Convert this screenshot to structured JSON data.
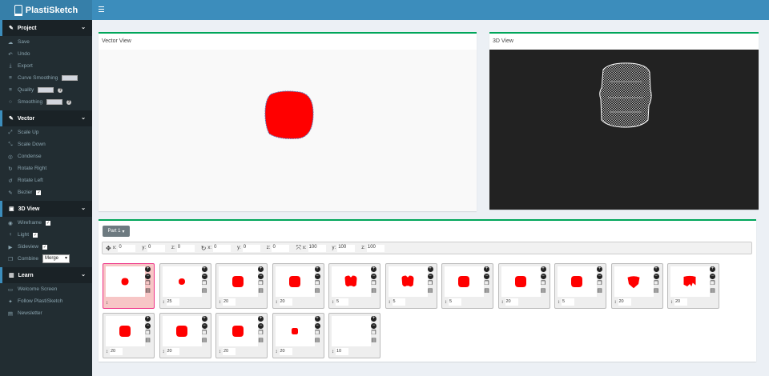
{
  "app": {
    "title": "PlastiSketch"
  },
  "sidebar": {
    "project": {
      "title": "Project",
      "items": [
        {
          "icon": "cloud-save-icon",
          "glyph": "☁",
          "label": "Save"
        },
        {
          "icon": "undo-icon",
          "glyph": "↶",
          "label": "Undo"
        },
        {
          "icon": "download-icon",
          "glyph": "⤓",
          "label": "Export"
        },
        {
          "icon": "sliders-icon",
          "glyph": "≡",
          "label": "Curve Smoothing"
        },
        {
          "icon": "sliders-icon",
          "glyph": "≡",
          "label": "Quality"
        },
        {
          "icon": "circle-icon",
          "glyph": "○",
          "label": "Smoothing"
        }
      ]
    },
    "vector": {
      "title": "Vector",
      "items": [
        {
          "icon": "expand-icon",
          "glyph": "⤢",
          "label": "Scale Up"
        },
        {
          "icon": "compress-icon",
          "glyph": "⤡",
          "label": "Scale Down"
        },
        {
          "icon": "dot-circle-icon",
          "glyph": "◎",
          "label": "Condense"
        },
        {
          "icon": "rotate-right-icon",
          "glyph": "↻",
          "label": "Rotate Right"
        },
        {
          "icon": "rotate-left-icon",
          "glyph": "↺",
          "label": "Rotate Left"
        },
        {
          "icon": "pen-icon",
          "glyph": "✎",
          "label": "Bezier"
        }
      ]
    },
    "view3d": {
      "title": "3D View",
      "items": [
        {
          "icon": "eye-icon",
          "glyph": "◉",
          "label": "Wireframe"
        },
        {
          "icon": "lightbulb-icon",
          "glyph": "♀",
          "label": "Light"
        },
        {
          "icon": "video-icon",
          "glyph": "▶",
          "label": "Sideview"
        },
        {
          "icon": "clone-icon",
          "glyph": "❐",
          "label": "Combine"
        }
      ],
      "combine_value": "Merge"
    },
    "learn": {
      "title": "Learn",
      "items": [
        {
          "icon": "tv-icon",
          "glyph": "▭",
          "label": "Welcome Screen"
        },
        {
          "icon": "twitter-icon",
          "glyph": "✦",
          "label": "Follow PlastiSketch"
        },
        {
          "icon": "newspaper-icon",
          "glyph": "▤",
          "label": "Newsletter"
        }
      ]
    }
  },
  "vector_view": {
    "title": "Vector View"
  },
  "view3d_panel": {
    "title": "3D View"
  },
  "parts": {
    "part_label": "Part 1",
    "transform": {
      "x": "0",
      "y": "0",
      "z": "0",
      "rx": "0",
      "ry": "0",
      "rz": "0",
      "sx": "100",
      "sy": "100",
      "sz": "100"
    },
    "layers": [
      {
        "height": "",
        "scale": 0.18,
        "shape": "blob"
      },
      {
        "height": "25",
        "scale": 0.16,
        "shape": "blob"
      },
      {
        "height": "20",
        "scale": 0.28,
        "shape": "round"
      },
      {
        "height": "20",
        "scale": 0.28,
        "shape": "round"
      },
      {
        "height": "5",
        "scale": 0.3,
        "shape": "notch"
      },
      {
        "height": "5",
        "scale": 0.3,
        "shape": "notch"
      },
      {
        "height": "5",
        "scale": 0.28,
        "shape": "round"
      },
      {
        "height": "20",
        "scale": 0.28,
        "shape": "round"
      },
      {
        "height": "5",
        "scale": 0.28,
        "shape": "round"
      },
      {
        "height": "20",
        "scale": 0.3,
        "shape": "drop"
      },
      {
        "height": "20",
        "scale": 0.3,
        "shape": "notch2"
      },
      {
        "height": "20",
        "scale": 0.28,
        "shape": "round"
      },
      {
        "height": "20",
        "scale": 0.28,
        "shape": "round"
      },
      {
        "height": "20",
        "scale": 0.28,
        "shape": "round"
      },
      {
        "height": "20",
        "scale": 0.16,
        "shape": "round"
      },
      {
        "height": "10",
        "scale": 0,
        "shape": "none"
      }
    ]
  },
  "colors": {
    "shape_fill": "#ff0000",
    "accent": "#3c8dbc",
    "sidebar": "#222d32"
  }
}
